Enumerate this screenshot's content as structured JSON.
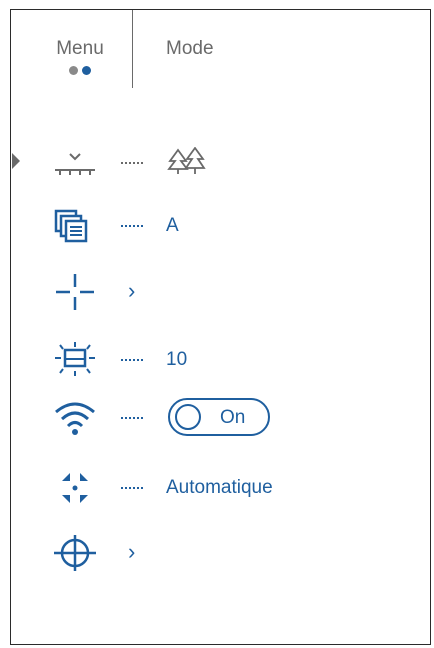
{
  "tabs": [
    {
      "label": "Menu",
      "active": true
    },
    {
      "label": "Mode",
      "active": false
    }
  ],
  "page_indicator": {
    "dots": 2,
    "current": 2,
    "dot_colors": [
      "#8a8a8a",
      "#1f5f9f"
    ]
  },
  "colors": {
    "accent": "#1f5f9f",
    "muted": "#6a6a6a",
    "border": "#2b2b2b"
  },
  "rows": [
    {
      "icon": "ground-level-icon",
      "value_icon": "forest-icon",
      "selected": true
    },
    {
      "icon": "gallery-icon",
      "value": "A"
    },
    {
      "icon": "crosshair-icon",
      "submenu": true
    },
    {
      "icon": "brightness-icon",
      "value": "10"
    },
    {
      "icon": "wifi-icon",
      "toggle": {
        "label": "On",
        "state": "on"
      }
    },
    {
      "icon": "auto-zoom-icon",
      "value": "Automatique"
    },
    {
      "icon": "zeroing-reticle-icon",
      "submenu": true
    }
  ]
}
